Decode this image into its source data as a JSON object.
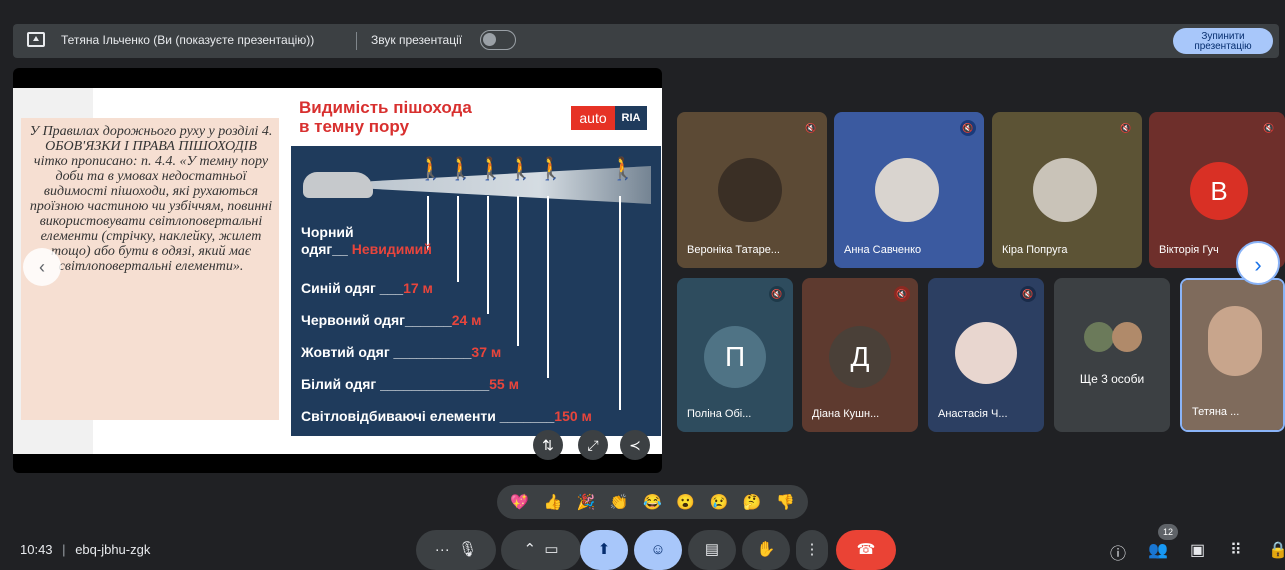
{
  "banner": {
    "presenter_text": "Тетяна Ільченко (Ви (показуєте презентацію))",
    "audio_label": "Звук презентації",
    "stop_button": "Зупинити презентацію"
  },
  "slide": {
    "text": "У Правилах дорожнього руху у розділі 4. ОБОВ'ЯЗКИ І ПРАВА ПІШОХОДІВ чітко прописано: п. 4.4. «У темну пору доби та в умовах недостатньої видимості пішоходи, які рухаються проїзною частиною чи узбіччям, повинні використовувати світлоповертальні елементи (стрічку, наклейку, жилет тощо) або бути в одязі, який має світлоповертальні елементи».",
    "info_title_line1": "Видимість пішохода",
    "info_title_line2": "в темну пору",
    "logo_auto": "auto",
    "logo_ria": "RIA",
    "rows": [
      {
        "label": "Чорний",
        "label2": "одяг__",
        "value": "Невидимий"
      },
      {
        "label": "Синій одяг",
        "dash": "___",
        "value": "17 м"
      },
      {
        "label": "Червоний одяг",
        "dash": "______",
        "value": "24 м"
      },
      {
        "label": "Жовтий одяг",
        "dash": "__________",
        "value": "37 м"
      },
      {
        "label": "Білий одяг",
        "dash": "______________",
        "value": "55 м"
      },
      {
        "label": "Світловідбиваючі елементи",
        "dash": "_______",
        "value": "150 м"
      }
    ]
  },
  "participants": {
    "row1": [
      {
        "name": "Вероніка Татаре...",
        "bg": "#5c4a35"
      },
      {
        "name": "Анна Савченко",
        "bg": "#3b5aa0"
      },
      {
        "name": "Кіра Попруга",
        "bg": "#5c5335"
      },
      {
        "name": "Вікторія Гуч",
        "bg": "#6e2f2b",
        "initial": "В"
      }
    ],
    "row2": [
      {
        "name": "Поліна Обі...",
        "bg": "#2e4c5e",
        "initial": "П"
      },
      {
        "name": "Діана Кушн...",
        "bg": "#5e3a2f",
        "initial": "Д"
      },
      {
        "name": "Анастасія Ч...",
        "bg": "#2c3f62"
      },
      {
        "name": "Ще 3 особи",
        "bg": "#3c4043"
      },
      {
        "name": "Тетяна ...",
        "bg": "#7f6b5c"
      }
    ]
  },
  "reactions": [
    "💖",
    "👍",
    "🎉",
    "👏",
    "😂",
    "😮",
    "😢",
    "🤔",
    "👎"
  ],
  "meeting": {
    "time": "10:43",
    "separator": "|",
    "code": "ebq-jbhu-zgk",
    "people_count": "12"
  },
  "colors": {
    "accent": "#a8c7fa",
    "end_call": "#ea4335"
  }
}
